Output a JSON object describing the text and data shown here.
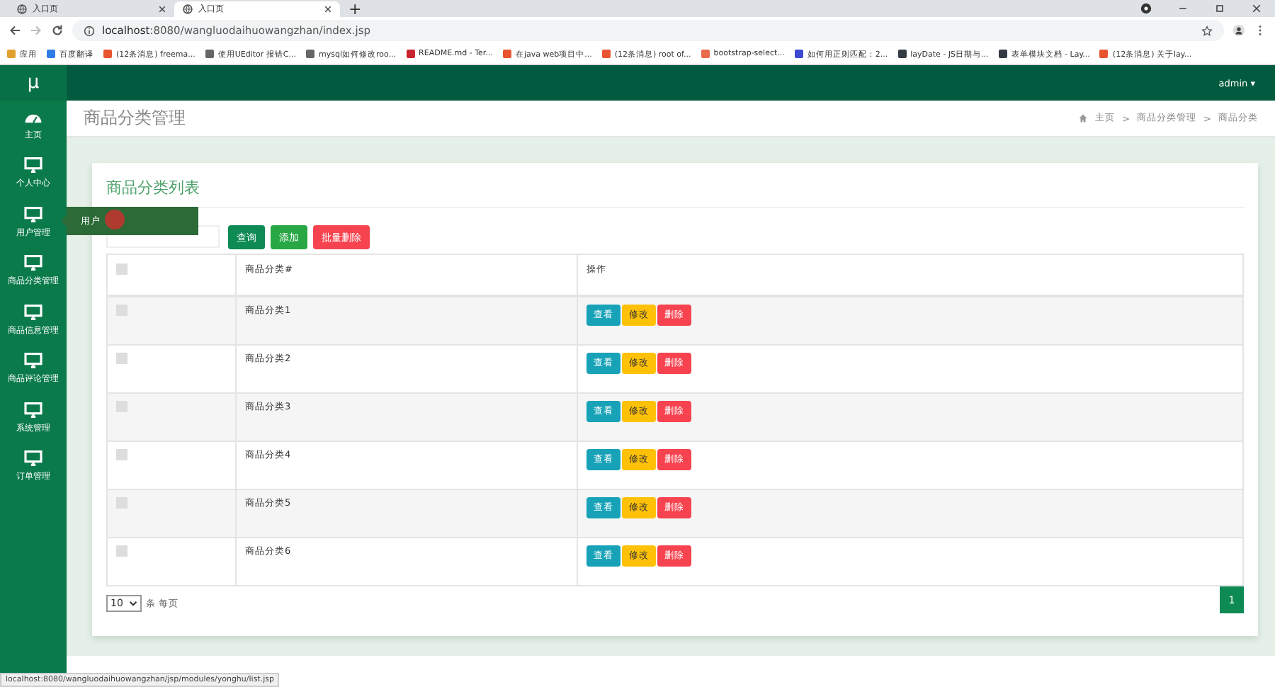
{
  "browser": {
    "tabs": [
      {
        "title": "入口页",
        "selected": false
      },
      {
        "title": "入口页",
        "selected": true
      }
    ],
    "new_tab": "+",
    "url_host": "localhost",
    "url_rest": ":8080/wangluodaihuowangzhan/index.jsp",
    "bookmarks": [
      {
        "label": "应用",
        "color": "#e0a030"
      },
      {
        "label": "百度翻译",
        "color": "#2f7be5"
      },
      {
        "label": "(12条消息) freema...",
        "color": "#e8542f"
      },
      {
        "label": "使用UEditor 报错C...",
        "color": "#666666"
      },
      {
        "label": "mysql如何修改roo...",
        "color": "#666666"
      },
      {
        "label": "README.md - Ter...",
        "color": "#c8242f"
      },
      {
        "label": "在java web项目中...",
        "color": "#e8542f"
      },
      {
        "label": "(12条消息) root of...",
        "color": "#e8542f"
      },
      {
        "label": "bootstrap-select...",
        "color": "#e86a4a"
      },
      {
        "label": "如何用正则匹配：2...",
        "color": "#3b4ad0"
      },
      {
        "label": "layDate - JS日期与...",
        "color": "#333a44"
      },
      {
        "label": "表单模块文档 - Lay...",
        "color": "#333a44"
      },
      {
        "label": "(12条消息) 关于lay...",
        "color": "#e8542f"
      }
    ],
    "status_url": "localhost:8080/wangluodaihuowangzhan/jsp/modules/yonghu/list.jsp"
  },
  "app": {
    "logo": "μ",
    "user": "admin ▾",
    "sidebar": [
      {
        "label": "主页",
        "kind": "dashboard",
        "expanded": false
      },
      {
        "label": "个人中心",
        "kind": "monitor",
        "expanded": false
      },
      {
        "label": "用户管理",
        "kind": "monitor",
        "expanded": true,
        "submenu": [
          "用户"
        ]
      },
      {
        "label": "商品分类管理",
        "kind": "monitor",
        "expanded": false
      },
      {
        "label": "商品信息管理",
        "kind": "monitor",
        "expanded": false
      },
      {
        "label": "商品评论管理",
        "kind": "monitor",
        "expanded": false
      },
      {
        "label": "系统管理",
        "kind": "monitor",
        "expanded": false
      },
      {
        "label": "订单管理",
        "kind": "monitor",
        "expanded": false
      }
    ],
    "page_title": "商品分类管理",
    "breadcrumb": [
      "主页",
      "商品分类管理",
      "商品分类"
    ],
    "card_title": "商品分类列表",
    "search_button": "查询",
    "add_button": "添加",
    "batch_delete_button": "批量删除",
    "breadcrumb_separators": [
      ">",
      ">"
    ],
    "table": {
      "columns": [
        "商品分类#",
        "操作"
      ],
      "all_checked": false,
      "rows": [
        {
          "name": "商品分类1",
          "checked": false,
          "actions": [
            "查看",
            "修改",
            "删除"
          ]
        },
        {
          "name": "商品分类2",
          "checked": false,
          "actions": [
            "查看",
            "修改",
            "删除"
          ]
        },
        {
          "name": "商品分类3",
          "checked": false,
          "actions": [
            "查看",
            "修改",
            "删除"
          ]
        },
        {
          "name": "商品分类4",
          "checked": false,
          "actions": [
            "查看",
            "修改",
            "删除"
          ]
        },
        {
          "name": "商品分类5",
          "checked": false,
          "actions": [
            "查看",
            "修改",
            "删除"
          ]
        },
        {
          "name": "商品分类6",
          "checked": false,
          "actions": [
            "查看",
            "修改",
            "删除"
          ]
        }
      ]
    },
    "page_size": "10",
    "page_size_suffix": "条 每页",
    "pages": [
      {
        "label": "1",
        "selected": true
      }
    ]
  }
}
